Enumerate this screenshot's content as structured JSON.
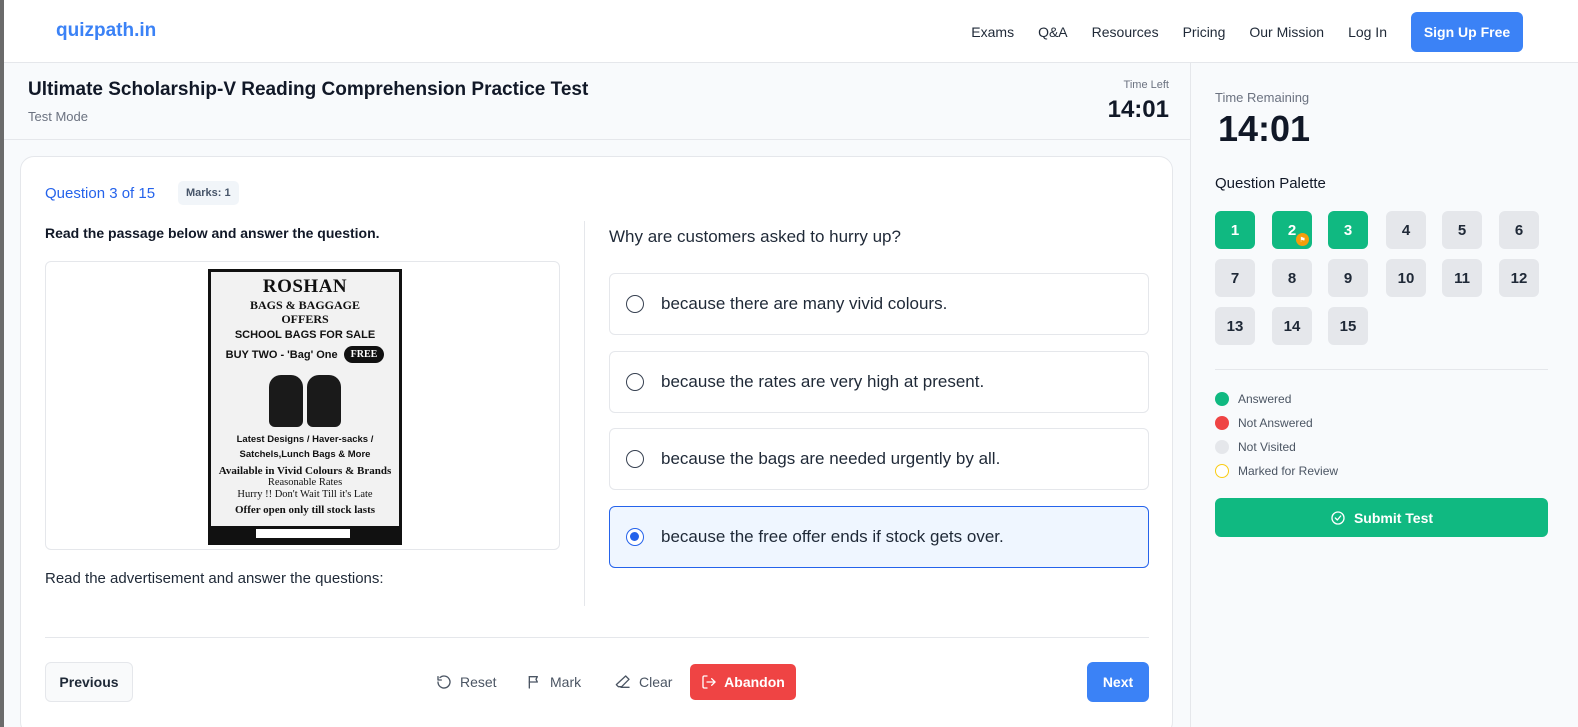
{
  "nav": {
    "brand": "quizpath.in",
    "links": [
      "Exams",
      "Q&A",
      "Resources",
      "Pricing",
      "Our Mission",
      "Log In"
    ],
    "signup": "Sign Up Free"
  },
  "header": {
    "title": "Ultimate Scholarship-V Reading Comprehension Practice Test",
    "mode": "Test Mode",
    "time_label": "Time Left",
    "time_value": "14:01"
  },
  "question": {
    "number_label": "Question 3 of 15",
    "marks": "Marks: 1",
    "instruction": "Read the passage below and answer the question.",
    "caption": "Read the advertisement and answer the questions:",
    "prompt": "Why are customers asked to hurry up?",
    "options": [
      "because there are many vivid colours.",
      "because the rates are very high at present.",
      "because the bags are needed urgently by all.",
      "because the free offer ends if stock gets over."
    ],
    "selected_index": 3
  },
  "advertisement": {
    "line1": "ROSHAN",
    "line2": "BAGS & BAGGAGE",
    "line3": "OFFERS",
    "line4": "SCHOOL BAGS FOR SALE",
    "line5": "BUY TWO - 'Bag' One",
    "free": "FREE",
    "line6a": "Latest Designs  / Haver-sacks /",
    "line6b": "Satchels,Lunch Bags & More",
    "line7": "Available in Vivid Colours & Brands",
    "line8": "Reasonable Rates",
    "line9": "Hurry !! Don't Wait Till it's Late",
    "line10": "Offer open only till stock lasts"
  },
  "footer": {
    "previous": "Previous",
    "reset": "Reset",
    "mark": "Mark",
    "clear": "Clear",
    "abandon": "Abandon",
    "next": "Next"
  },
  "sidebar": {
    "time_label": "Time Remaining",
    "time_value": "14:01",
    "palette_title": "Question Palette",
    "questions": [
      "1",
      "2",
      "3",
      "4",
      "5",
      "6",
      "7",
      "8",
      "9",
      "10",
      "11",
      "12",
      "13",
      "14",
      "15"
    ],
    "answered": [
      1,
      2,
      3
    ],
    "marked_for_review": [
      2
    ],
    "legend": [
      "Answered",
      "Not Answered",
      "Not Visited",
      "Marked for Review"
    ],
    "submit": "Submit Test"
  },
  "colors": {
    "accent": "#3b82f6",
    "answered": "#10b981",
    "not_answered": "#ef4444",
    "not_visited": "#e5e7eb",
    "review": "#facc15"
  }
}
